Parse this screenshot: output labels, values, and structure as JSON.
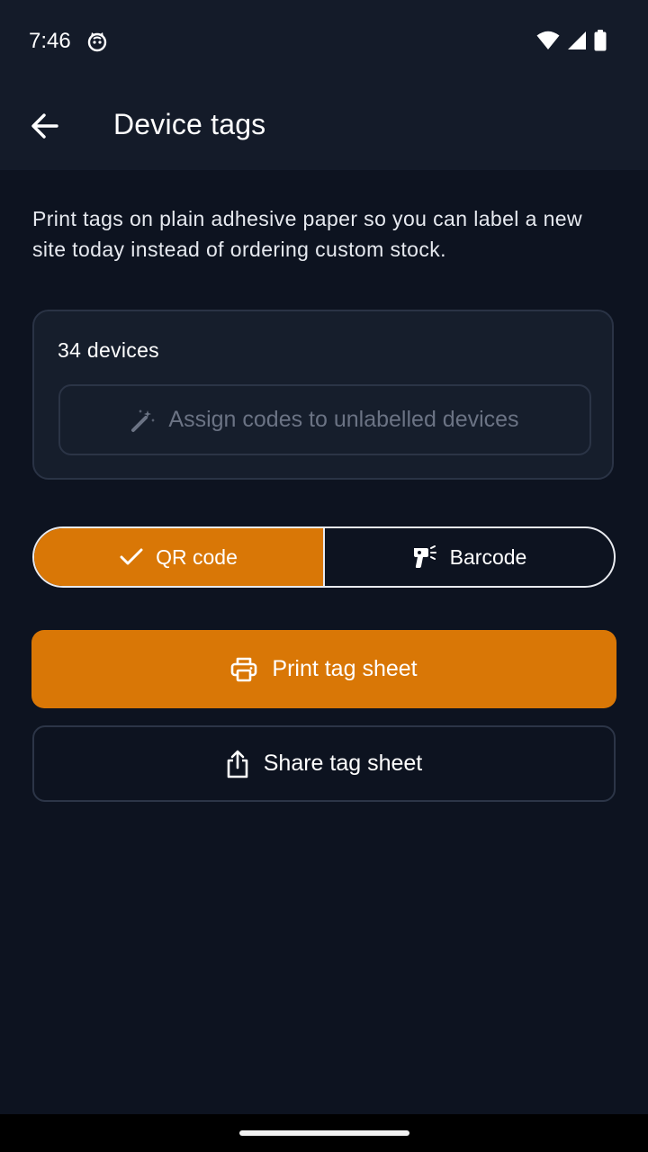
{
  "status_bar": {
    "time": "7:46",
    "app_icon": "cat-face-icon",
    "icons": [
      "wifi-icon",
      "cellular-signal-icon",
      "battery-icon"
    ]
  },
  "app_bar": {
    "back_icon": "arrow-left-icon",
    "title": "Device tags"
  },
  "description": "Print tags on plain adhesive paper so you can label a new site today instead of ordering custom stock.",
  "devices_card": {
    "count_label": "34 devices",
    "assign_button": {
      "icon": "magic-wand-icon",
      "label": "Assign codes to unlabelled devices",
      "enabled": false
    }
  },
  "format_toggle": {
    "options": [
      {
        "label": "QR code",
        "icon": "check-icon",
        "selected": true
      },
      {
        "label": "Barcode",
        "icon": "barcode-scanner-icon",
        "selected": false
      }
    ]
  },
  "actions": {
    "print": {
      "label": "Print tag sheet",
      "icon": "printer-icon"
    },
    "share": {
      "label": "Share tag sheet",
      "icon": "share-icon"
    }
  },
  "colors": {
    "background": "#0d1320",
    "surface": "#141b29",
    "accent": "#d97706",
    "disabled_text": "#6b7384"
  }
}
